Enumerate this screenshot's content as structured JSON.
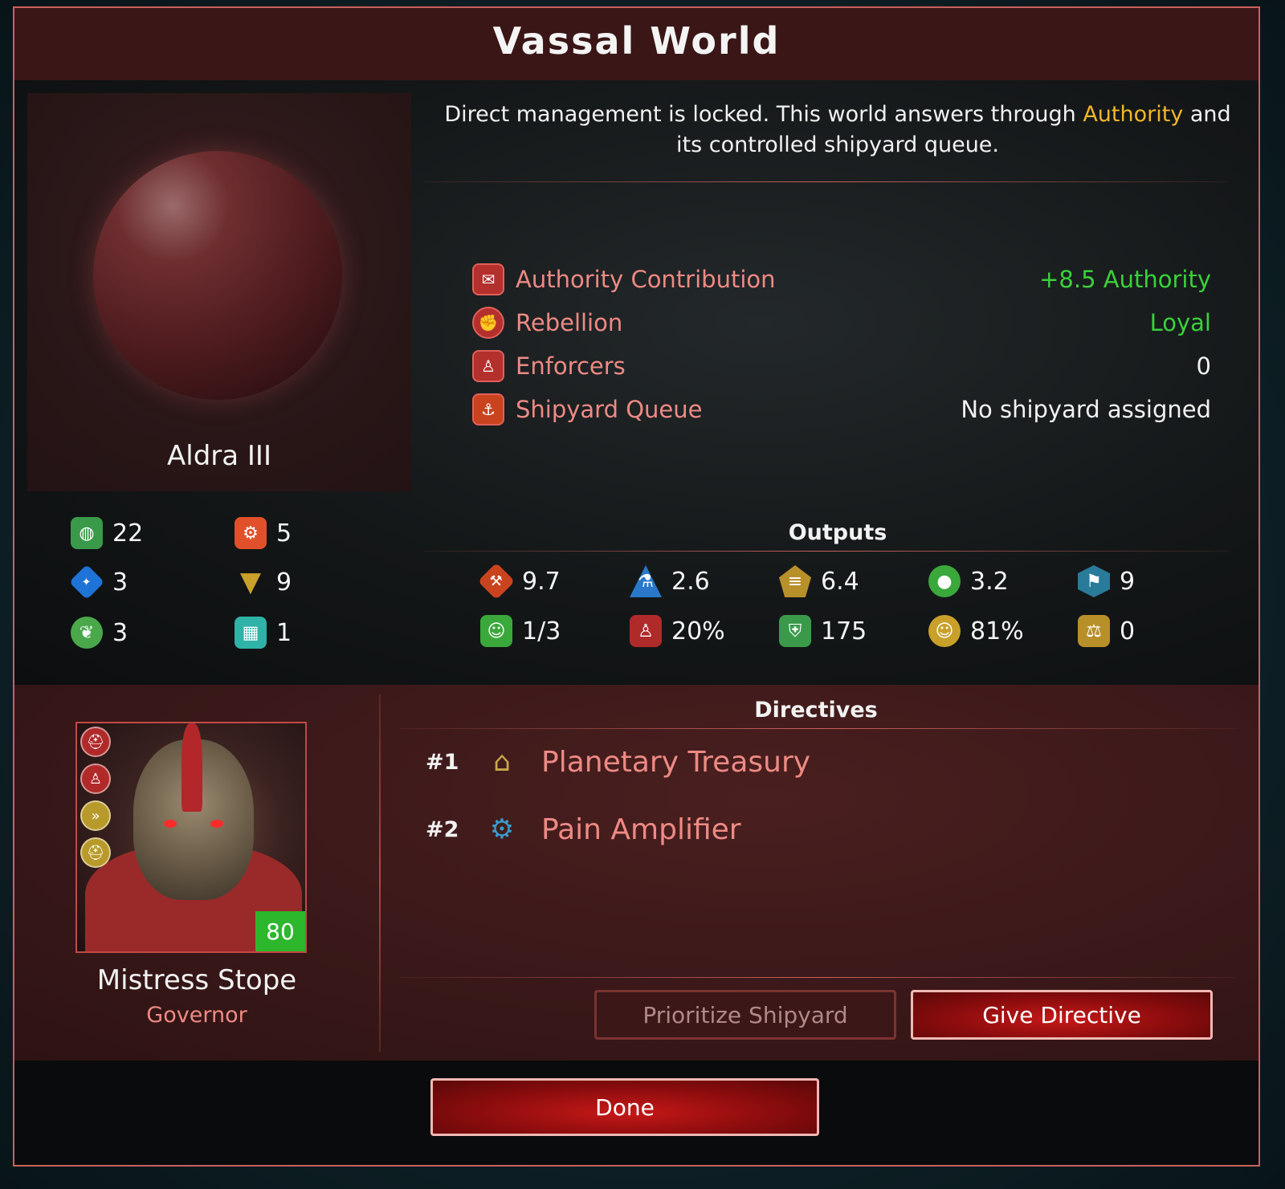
{
  "dialog": {
    "title": "Vassal World"
  },
  "planet": {
    "name": "Aldra III"
  },
  "resources": [
    {
      "icon": "planet-icon",
      "value": "22",
      "color": "#3a9a4a"
    },
    {
      "icon": "gear-icon",
      "value": "5",
      "color": "#e0502a"
    },
    {
      "icon": "crystal-icon",
      "value": "3",
      "color": "#1e73d6"
    },
    {
      "icon": "diamond-icon",
      "value": "9",
      "color": "#c9a02a"
    },
    {
      "icon": "leaf-icon",
      "value": "3",
      "color": "#4aa84a"
    },
    {
      "icon": "building-icon",
      "value": "1",
      "color": "#2fb3a8"
    }
  ],
  "description": {
    "before": "Direct management is locked. This world answers through ",
    "highlight": "Authority",
    "after": " and its controlled shipyard queue."
  },
  "stats": [
    {
      "icon": "authority-icon",
      "glyph": "✉",
      "label": "Authority Contribution",
      "value": "+8.5 Authority",
      "color": "#3ad13a"
    },
    {
      "icon": "fist-icon",
      "glyph": "✊",
      "label": "Rebellion",
      "value": "Loyal",
      "color": "#3ad13a"
    },
    {
      "icon": "enforcer-icon",
      "glyph": "♙",
      "label": "Enforcers",
      "value": "0",
      "color": "#f2f2f2"
    },
    {
      "icon": "shipyard-icon",
      "glyph": "⚓",
      "label": "Shipyard Queue",
      "value": "No shipyard assigned",
      "color": "#f2f2f2"
    }
  ],
  "outputs": {
    "title": "Outputs",
    "items": [
      {
        "icon": "hammer-icon",
        "glyph": "⚒",
        "value": "9.7",
        "color": "#c9441e"
      },
      {
        "icon": "science-flask-icon",
        "glyph": "⚗",
        "value": "2.6",
        "color": "#2a78c9"
      },
      {
        "icon": "credits-icon",
        "glyph": "≡",
        "value": "6.4",
        "color": "#b8902a"
      },
      {
        "icon": "food-apple-icon",
        "glyph": "●",
        "value": "3.2",
        "color": "#3aa83a"
      },
      {
        "icon": "influence-flag-icon",
        "glyph": "⚑",
        "value": "9",
        "color": "#2a7a9a"
      },
      {
        "icon": "population-icon",
        "glyph": "☺",
        "value": "1/3",
        "color": "#3aa83a"
      },
      {
        "icon": "unrest-icon",
        "glyph": "♙",
        "value": "20%",
        "color": "#b02a2a"
      },
      {
        "icon": "shield-icon",
        "glyph": "⛨",
        "value": "175",
        "color": "#3a9a4a"
      },
      {
        "icon": "approval-face-icon",
        "glyph": "☹",
        "value": "81%",
        "color": "#c9a02a"
      },
      {
        "icon": "justice-scales-icon",
        "glyph": "⚖",
        "value": "0",
        "color": "#b8902a"
      }
    ]
  },
  "governor": {
    "name": "Mistress Stope",
    "role": "Governor",
    "level": "80",
    "traits": [
      {
        "icon": "helmet-trait-icon",
        "color": "#b02a2a"
      },
      {
        "icon": "figure-trait-icon",
        "color": "#b02a2a"
      },
      {
        "icon": "speed-chevrons-trait-icon",
        "color": "#b89a2a"
      },
      {
        "icon": "helmet-gold-trait-icon",
        "color": "#b89a2a"
      }
    ]
  },
  "directives": {
    "title": "Directives",
    "items": [
      {
        "rank": "#1",
        "icon": "treasury-building-icon",
        "label": "Planetary Treasury"
      },
      {
        "rank": "#2",
        "icon": "pain-amplifier-device-icon",
        "label": "Pain Amplifier"
      }
    ]
  },
  "buttons": {
    "prioritize": "Prioritize Shipyard",
    "give": "Give Directive",
    "done": "Done"
  }
}
